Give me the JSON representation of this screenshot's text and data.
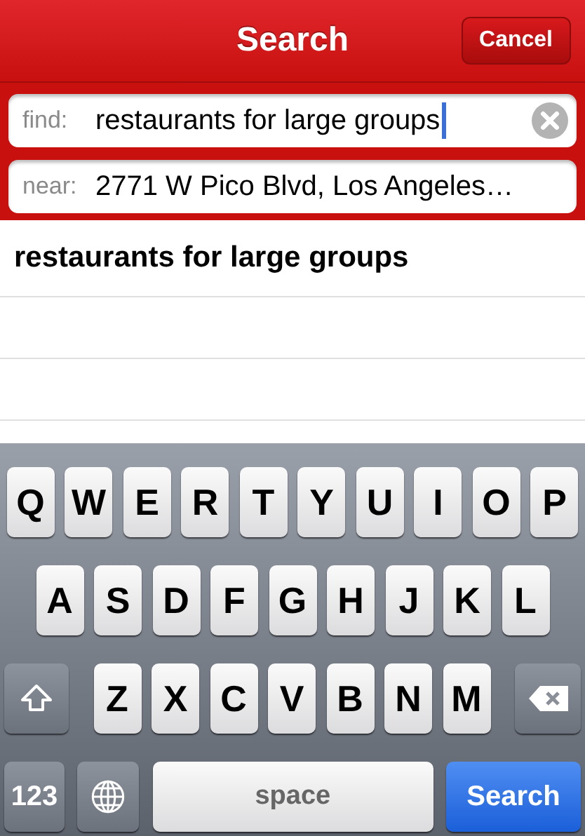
{
  "nav_bar": {
    "title": "Search",
    "cancel_button": "Cancel"
  },
  "fields": [
    {
      "label": "find:",
      "value": "restaurants for large groups",
      "focused": true,
      "clear_button": true
    },
    {
      "label": "near:",
      "value": "2771 W Pico Blvd, Los Angeles…",
      "focused": false,
      "clear_button": false
    }
  ],
  "suggestions": [
    {
      "text": "restaurants for large groups"
    }
  ],
  "keyboard": {
    "rows": [
      [
        "Q",
        "W",
        "E",
        "R",
        "T",
        "Y",
        "U",
        "I",
        "O",
        "P"
      ],
      [
        "A",
        "S",
        "D",
        "F",
        "G",
        "H",
        "J",
        "K",
        "L"
      ],
      [
        "Z",
        "X",
        "C",
        "V",
        "B",
        "N",
        "M"
      ]
    ],
    "numbers_key": "123",
    "space_key": "space",
    "return_key": "Search"
  }
}
